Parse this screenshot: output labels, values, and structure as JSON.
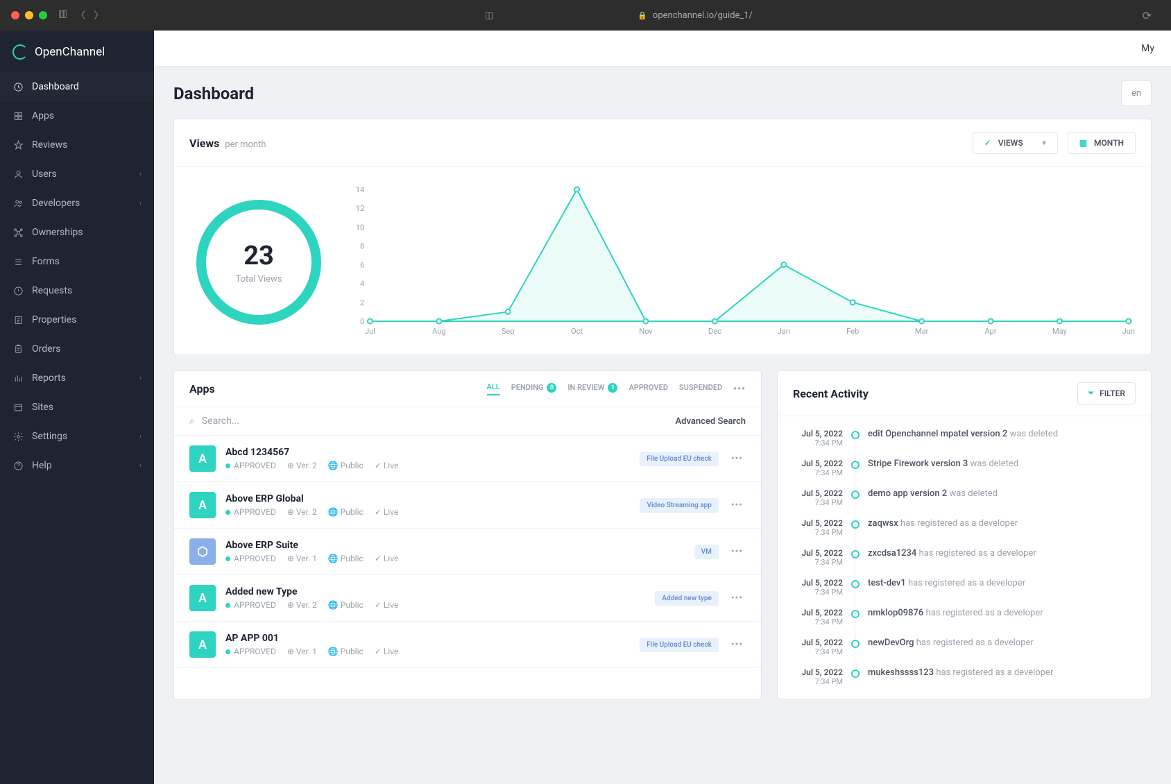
{
  "browser": {
    "url": "openchannel.io/guide_1/"
  },
  "brand": {
    "name": "OpenChannel"
  },
  "sidebar": {
    "items": [
      {
        "label": "Dashboard",
        "icon": "dashboard",
        "active": true,
        "expand": false
      },
      {
        "label": "Apps",
        "icon": "apps",
        "active": false,
        "expand": false
      },
      {
        "label": "Reviews",
        "icon": "star",
        "active": false,
        "expand": false
      },
      {
        "label": "Users",
        "icon": "user",
        "active": false,
        "expand": true
      },
      {
        "label": "Developers",
        "icon": "users",
        "active": false,
        "expand": true
      },
      {
        "label": "Ownerships",
        "icon": "ownership",
        "active": false,
        "expand": false
      },
      {
        "label": "Forms",
        "icon": "forms",
        "active": false,
        "expand": false
      },
      {
        "label": "Requests",
        "icon": "requests",
        "active": false,
        "expand": false
      },
      {
        "label": "Properties",
        "icon": "properties",
        "active": false,
        "expand": false
      },
      {
        "label": "Orders",
        "icon": "orders",
        "active": false,
        "expand": false
      },
      {
        "label": "Reports",
        "icon": "reports",
        "active": false,
        "expand": true
      },
      {
        "label": "Sites",
        "icon": "sites",
        "active": false,
        "expand": false
      },
      {
        "label": "Settings",
        "icon": "settings",
        "active": false,
        "expand": true
      },
      {
        "label": "Help",
        "icon": "help",
        "active": false,
        "expand": true
      }
    ]
  },
  "topbar": {
    "right_text": "My"
  },
  "page": {
    "title": "Dashboard",
    "header_input": "en"
  },
  "views": {
    "title": "Views",
    "subtitle": "per month",
    "metric_select": "VIEWS",
    "period_select": "MONTH",
    "total_value": "23",
    "total_label": "Total Views"
  },
  "chart_data": {
    "type": "line",
    "categories": [
      "Jul",
      "Aug",
      "Sep",
      "Oct",
      "Nov",
      "Dec",
      "Jan",
      "Feb",
      "Mar",
      "Apr",
      "May",
      "Jun"
    ],
    "values": [
      0,
      0,
      1,
      14,
      0,
      0,
      6,
      2,
      0,
      0,
      0,
      0
    ],
    "ylabel": "",
    "xlabel": "",
    "ylim": [
      0,
      14
    ],
    "y_ticks": [
      0,
      2,
      4,
      6,
      8,
      10,
      12,
      14
    ]
  },
  "apps": {
    "title": "Apps",
    "tabs": [
      {
        "label": "ALL",
        "active": true,
        "count": null
      },
      {
        "label": "PENDING",
        "active": false,
        "count": "0"
      },
      {
        "label": "IN REVIEW",
        "active": false,
        "count": "1"
      },
      {
        "label": "APPROVED",
        "active": false,
        "count": null
      },
      {
        "label": "SUSPENDED",
        "active": false,
        "count": null
      }
    ],
    "search_placeholder": "Search...",
    "advanced_search": "Advanced Search",
    "rows": [
      {
        "name": "Abcd 1234567",
        "status": "APPROVED",
        "version": "Ver. 2",
        "visibility": "Public",
        "live": "Live",
        "tag": "File Upload EU check",
        "icon": "A",
        "icon_color": "green"
      },
      {
        "name": "Above ERP Global",
        "status": "APPROVED",
        "version": "Ver. 2",
        "visibility": "Public",
        "live": "Live",
        "tag": "Video Streaming app",
        "icon": "A",
        "icon_color": "green"
      },
      {
        "name": "Above ERP Suite",
        "status": "APPROVED",
        "version": "Ver. 1",
        "visibility": "Public",
        "live": "Live",
        "tag": "VM",
        "icon": "⬡",
        "icon_color": "blue"
      },
      {
        "name": "Added new Type",
        "status": "APPROVED",
        "version": "Ver. 2",
        "visibility": "Public",
        "live": "Live",
        "tag": "Added new type",
        "icon": "A",
        "icon_color": "green"
      },
      {
        "name": "AP APP 001",
        "status": "APPROVED",
        "version": "Ver. 1",
        "visibility": "Public",
        "live": "Live",
        "tag": "File Upload EU check",
        "icon": "A",
        "icon_color": "green"
      }
    ]
  },
  "activity": {
    "title": "Recent Activity",
    "filter_label": "FILTER",
    "rows": [
      {
        "date": "Jul 5, 2022",
        "time": "7:34 PM",
        "subject": "edit Openchannel mpatel version 2",
        "action": "was deleted"
      },
      {
        "date": "Jul 5, 2022",
        "time": "7:34 PM",
        "subject": "Stripe Firework version 3",
        "action": "was deleted"
      },
      {
        "date": "Jul 5, 2022",
        "time": "7:34 PM",
        "subject": "demo app version 2",
        "action": "was deleted"
      },
      {
        "date": "Jul 5, 2022",
        "time": "7:34 PM",
        "subject": "zaqwsx",
        "action": "has registered as a developer"
      },
      {
        "date": "Jul 5, 2022",
        "time": "7:34 PM",
        "subject": "zxcdsa1234",
        "action": "has registered as a developer"
      },
      {
        "date": "Jul 5, 2022",
        "time": "7:34 PM",
        "subject": "test-dev1",
        "action": "has registered as a developer"
      },
      {
        "date": "Jul 5, 2022",
        "time": "7:34 PM",
        "subject": "nmklop09876",
        "action": "has registered as a developer"
      },
      {
        "date": "Jul 5, 2022",
        "time": "7:34 PM",
        "subject": "newDevOrg",
        "action": "has registered as a developer"
      },
      {
        "date": "Jul 5, 2022",
        "time": "7:34 PM",
        "subject": "mukeshssss123",
        "action": "has registered as a developer"
      }
    ]
  }
}
